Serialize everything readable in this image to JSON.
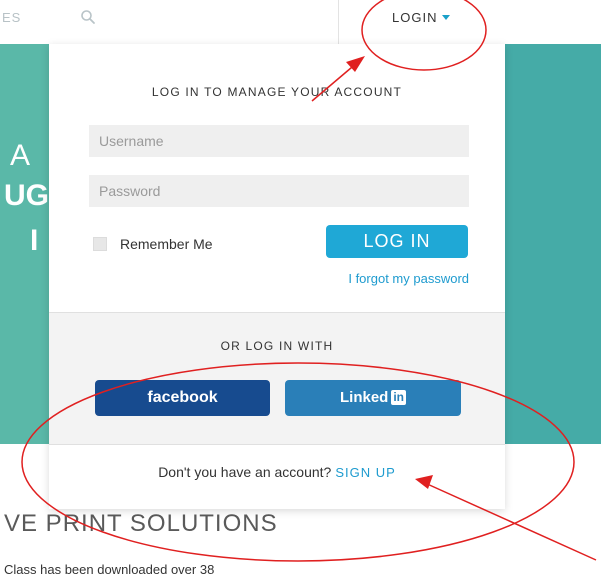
{
  "header": {
    "nav_fragment": "ES",
    "login_label": "LOGIN"
  },
  "hero": {
    "line1": "A",
    "line2": "UG",
    "line3": "I"
  },
  "login_panel": {
    "heading": "LOG IN TO MANAGE YOUR ACCOUNT",
    "username_placeholder": "Username",
    "password_placeholder": "Password",
    "remember_label": "Remember Me",
    "login_button": "LOG IN",
    "forgot_link": "I forgot my password",
    "social_heading": "OR LOG IN WITH",
    "facebook_label": "facebook",
    "linkedin_label": "Linked",
    "linkedin_badge": "in",
    "footer_text": "Don't you have an account?",
    "signup_link": "SIGN UP"
  },
  "page": {
    "section_title": "VE PRINT SOLUTIONS",
    "download_text": "Class has been downloaded over 38"
  },
  "colors": {
    "accent": "#1fa8d6",
    "hero": "#45aba7",
    "facebook": "#174b8f",
    "linkedin": "#2a7fb8",
    "annotation": "#e02020"
  }
}
